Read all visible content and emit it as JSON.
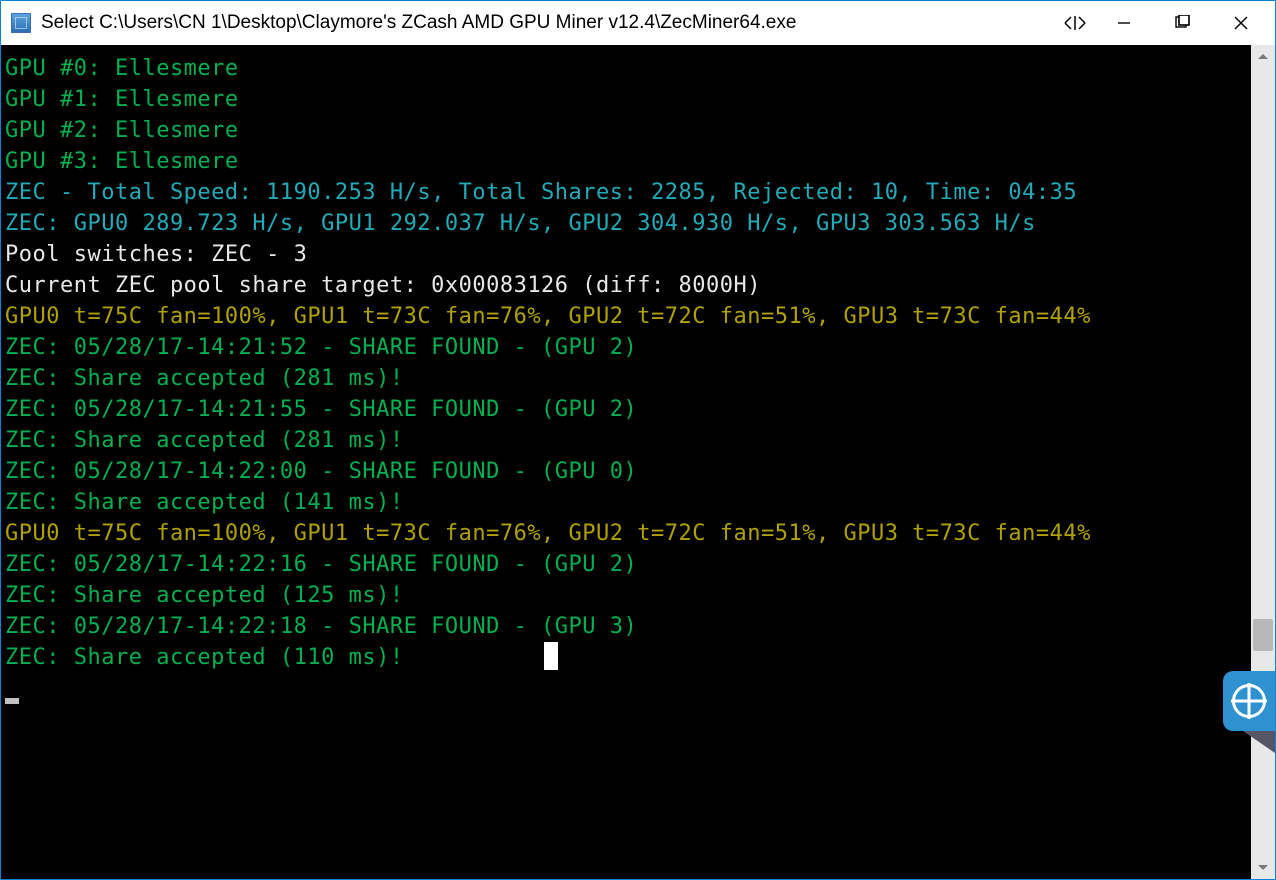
{
  "window": {
    "title": "Select C:\\Users\\CN 1\\Desktop\\Claymore's ZCash AMD GPU Miner v12.4\\ZecMiner64.exe"
  },
  "gpus": [
    {
      "idx": 0,
      "name": "Ellesmere"
    },
    {
      "idx": 1,
      "name": "Ellesmere"
    },
    {
      "idx": 2,
      "name": "Ellesmere"
    },
    {
      "idx": 3,
      "name": "Ellesmere"
    }
  ],
  "summary": {
    "coin": "ZEC",
    "total_speed": "1190.253 H/s",
    "total_shares": 2285,
    "rejected": 10,
    "time": "04:35"
  },
  "per_gpu_speed": [
    {
      "gpu": 0,
      "hs": "289.723 H/s"
    },
    {
      "gpu": 1,
      "hs": "292.037 H/s"
    },
    {
      "gpu": 2,
      "hs": "304.930 H/s"
    },
    {
      "gpu": 3,
      "hs": "303.563 H/s"
    }
  ],
  "pool_switches": "ZEC - 3",
  "pool_target": {
    "target": "0x00083126",
    "diff": "8000H"
  },
  "temps": [
    {
      "gpu": 0,
      "t": "75C",
      "fan": "100%"
    },
    {
      "gpu": 1,
      "t": "73C",
      "fan": "76%"
    },
    {
      "gpu": 2,
      "t": "72C",
      "fan": "51%"
    },
    {
      "gpu": 3,
      "t": "73C",
      "fan": "44%"
    }
  ],
  "events": [
    {
      "ts": "05/28/17-14:21:52",
      "kind": "found",
      "gpu": 2
    },
    {
      "ms": 281,
      "kind": "accepted"
    },
    {
      "ts": "05/28/17-14:21:55",
      "kind": "found",
      "gpu": 2
    },
    {
      "ms": 281,
      "kind": "accepted"
    },
    {
      "ts": "05/28/17-14:22:00",
      "kind": "found",
      "gpu": 0
    },
    {
      "ms": 141,
      "kind": "accepted"
    },
    {
      "kind": "temps"
    },
    {
      "ts": "05/28/17-14:22:16",
      "kind": "found",
      "gpu": 2
    },
    {
      "ms": 125,
      "kind": "accepted"
    },
    {
      "ts": "05/28/17-14:22:18",
      "kind": "found",
      "gpu": 3
    },
    {
      "ms": 110,
      "kind": "accepted"
    }
  ],
  "colors": {
    "green": "#00b050",
    "cyan": "#22aab8",
    "white": "#e8e8e8",
    "olive": "#b0a000"
  }
}
